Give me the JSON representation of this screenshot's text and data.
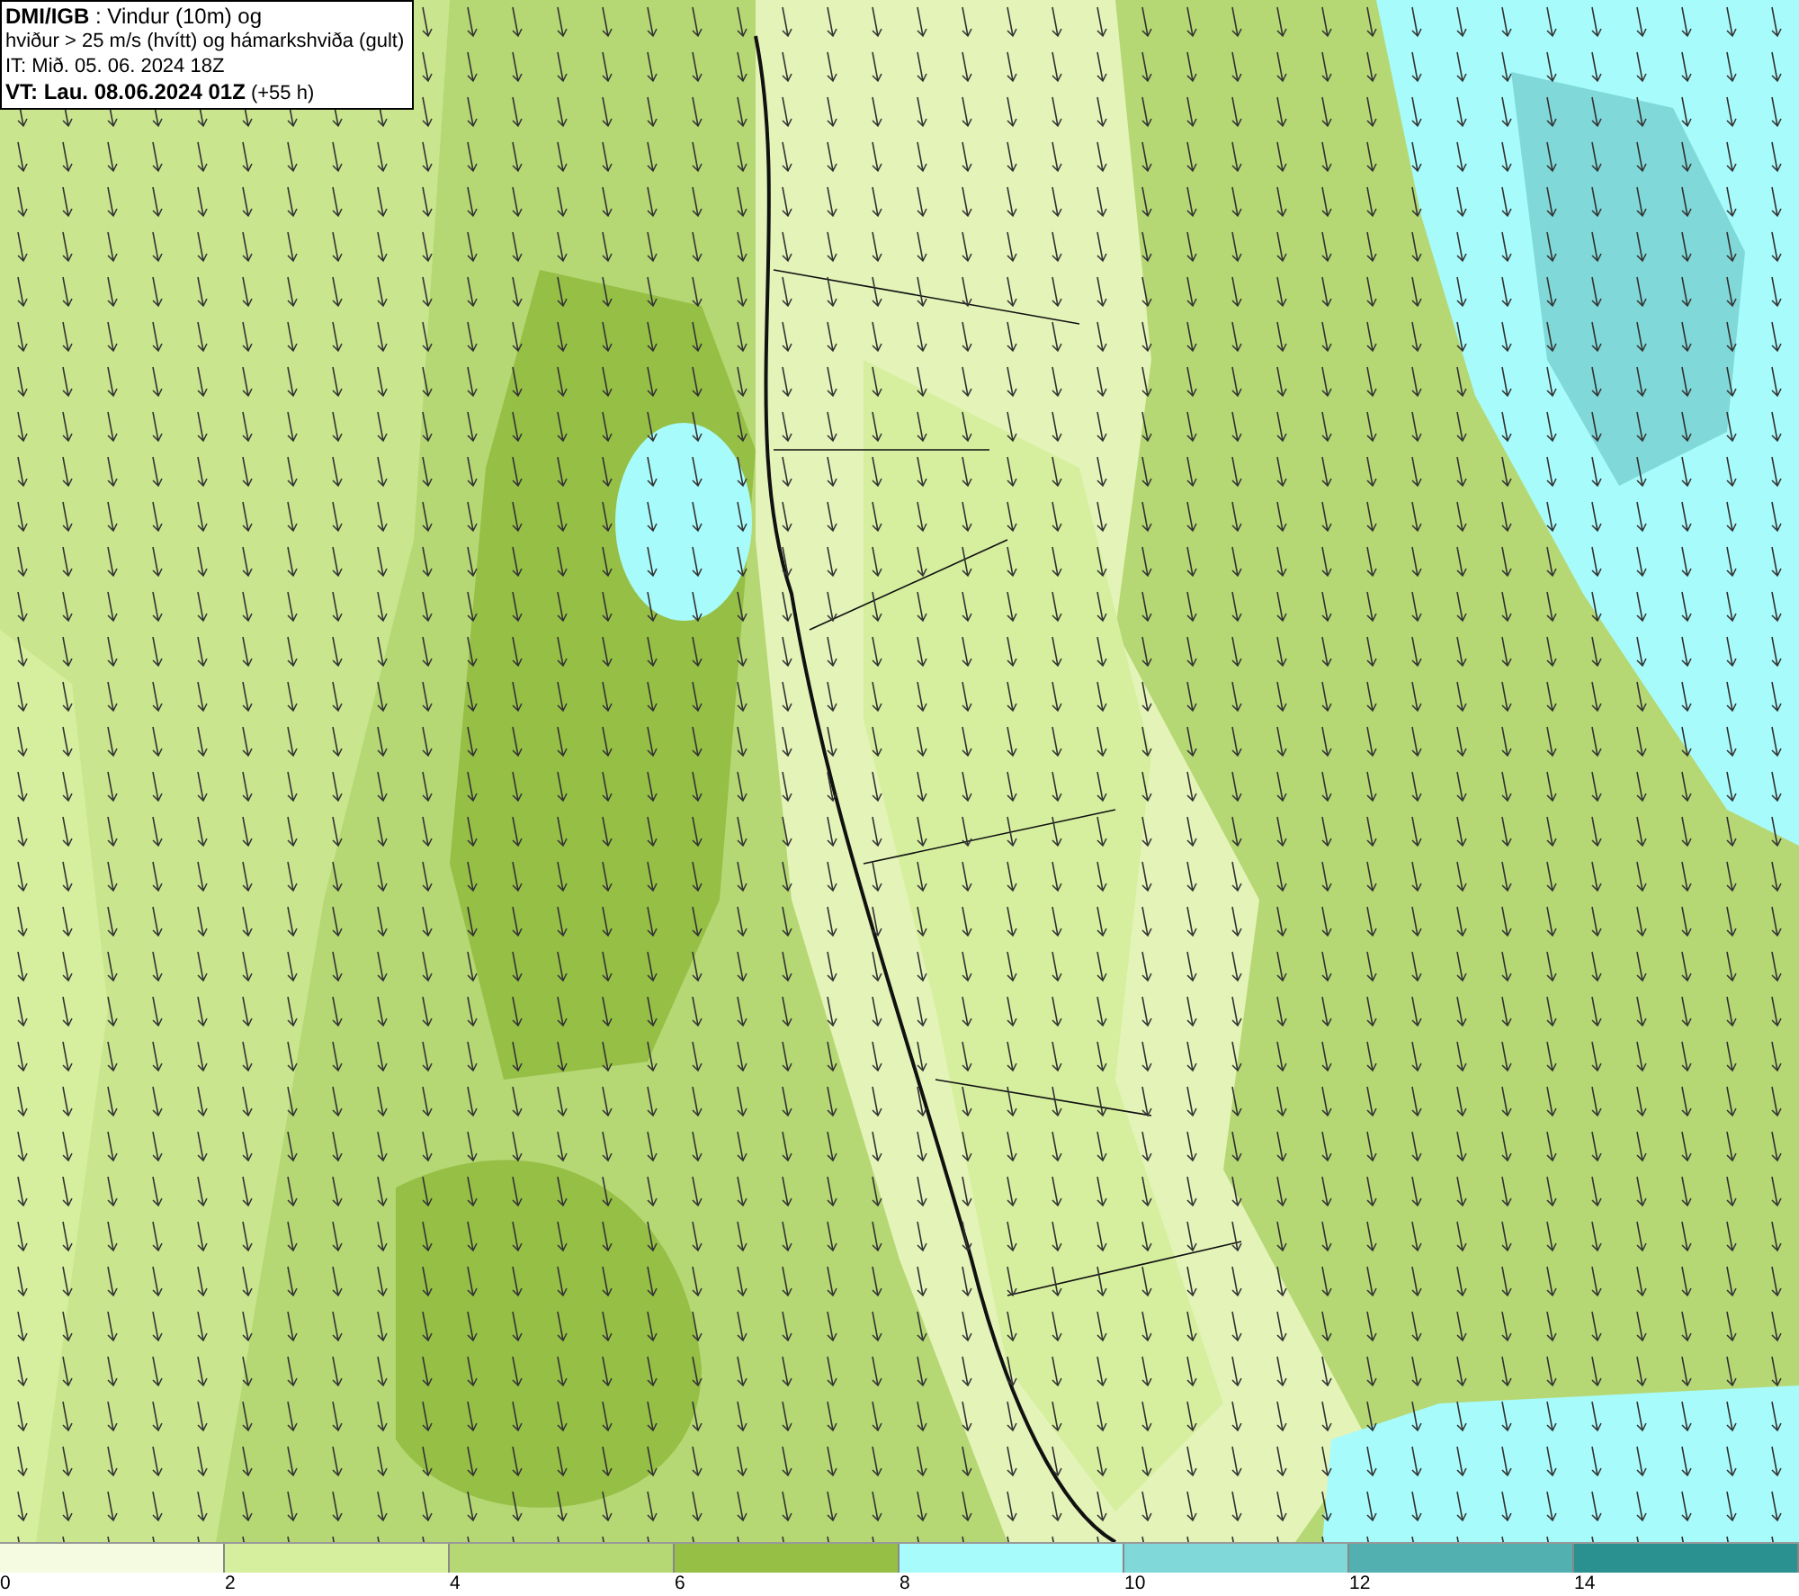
{
  "header": {
    "lines": [
      "**DMI/IGB** : Vindur (10m) og",
      "hviður > 25 m/s (hvítt) og hámarkshviða (gult)",
      "IT: Mið. 05. 06. 2024 18Z",
      "**VT: Lau. 08.06.2024 01Z** (+55 h)"
    ]
  },
  "legend": {
    "bins": [
      {
        "color": "#f4fbe0",
        "label": "0"
      },
      {
        "color": "#d6ef9e",
        "label": "2"
      },
      {
        "color": "#b5d874",
        "label": "4"
      },
      {
        "color": "#96bf46",
        "label": "6"
      },
      {
        "color": "#a8fbfb",
        "label": "8"
      },
      {
        "color": "#80d8d8",
        "label": "10"
      },
      {
        "color": "#52b0b0",
        "label": "12"
      },
      {
        "color": "#2a9090",
        "label": "14"
      }
    ]
  }
}
